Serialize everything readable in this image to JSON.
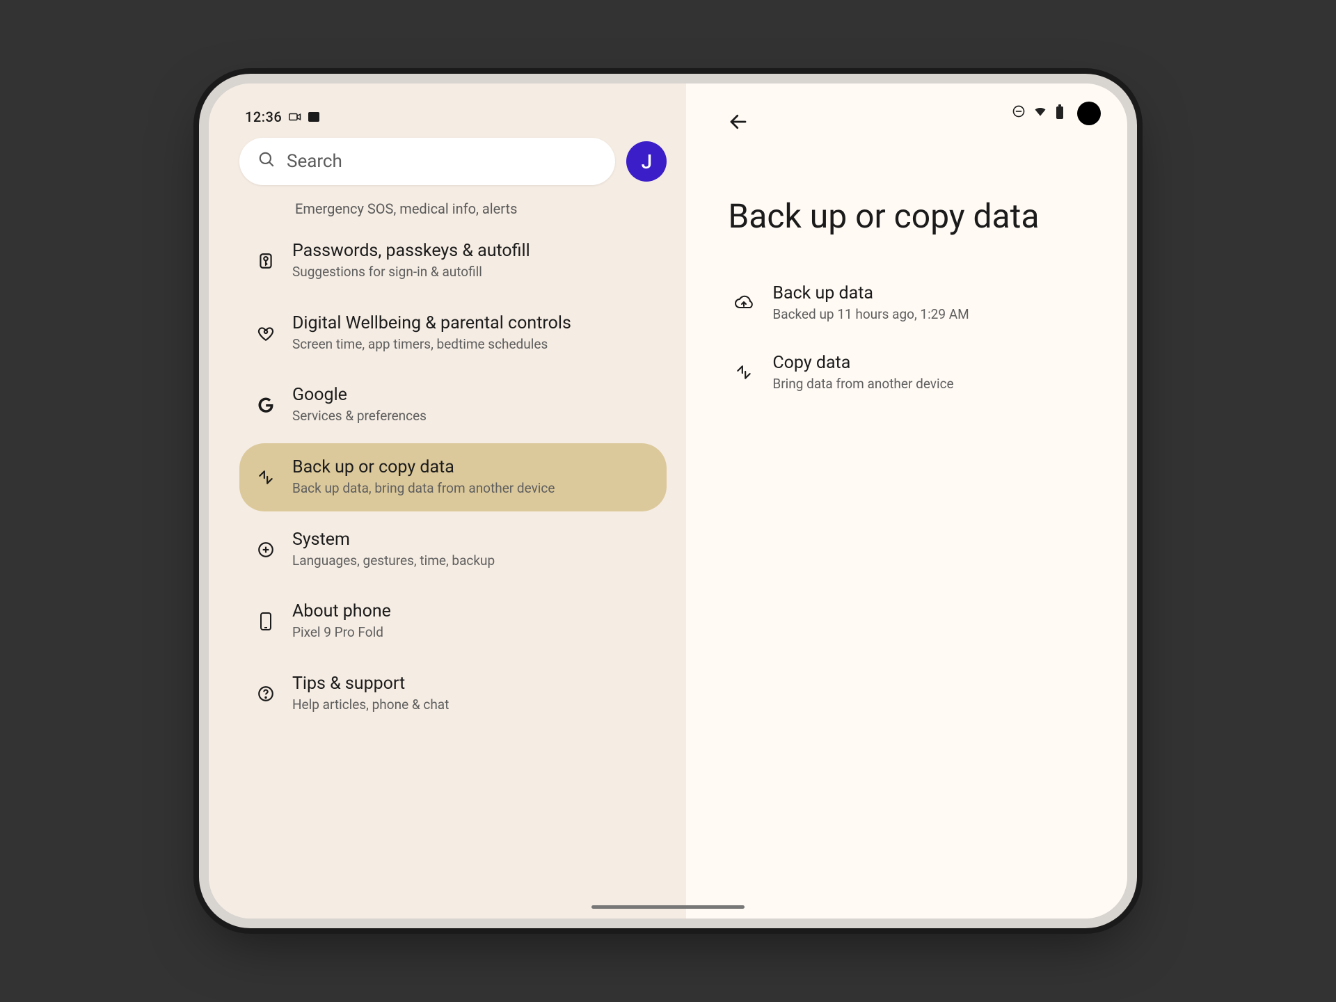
{
  "status": {
    "time": "12:36"
  },
  "search": {
    "placeholder": "Search"
  },
  "avatar": {
    "initial": "J"
  },
  "partial_item_subtitle": "Emergency SOS, medical info, alerts",
  "settings": [
    {
      "icon": "key",
      "title": "Passwords, passkeys & autofill",
      "subtitle": "Suggestions for sign-in & autofill",
      "selected": false
    },
    {
      "icon": "wellbeing",
      "title": "Digital Wellbeing & parental controls",
      "subtitle": "Screen time, app timers, bedtime schedules",
      "selected": false
    },
    {
      "icon": "google",
      "title": "Google",
      "subtitle": "Services & preferences",
      "selected": false
    },
    {
      "icon": "backup",
      "title": "Back up or copy data",
      "subtitle": "Back up data, bring data from another device",
      "selected": true
    },
    {
      "icon": "system",
      "title": "System",
      "subtitle": "Languages, gestures, time, backup",
      "selected": false
    },
    {
      "icon": "about",
      "title": "About phone",
      "subtitle": "Pixel 9 Pro Fold",
      "selected": false
    },
    {
      "icon": "support",
      "title": "Tips & support",
      "subtitle": "Help articles, phone & chat",
      "selected": false
    }
  ],
  "right": {
    "title": "Back up or copy data",
    "items": [
      {
        "icon": "cloud-up",
        "title": "Back up data",
        "subtitle": "Backed up 11 hours ago, 1:29 AM"
      },
      {
        "icon": "merge",
        "title": "Copy data",
        "subtitle": "Bring data from another device"
      }
    ]
  }
}
